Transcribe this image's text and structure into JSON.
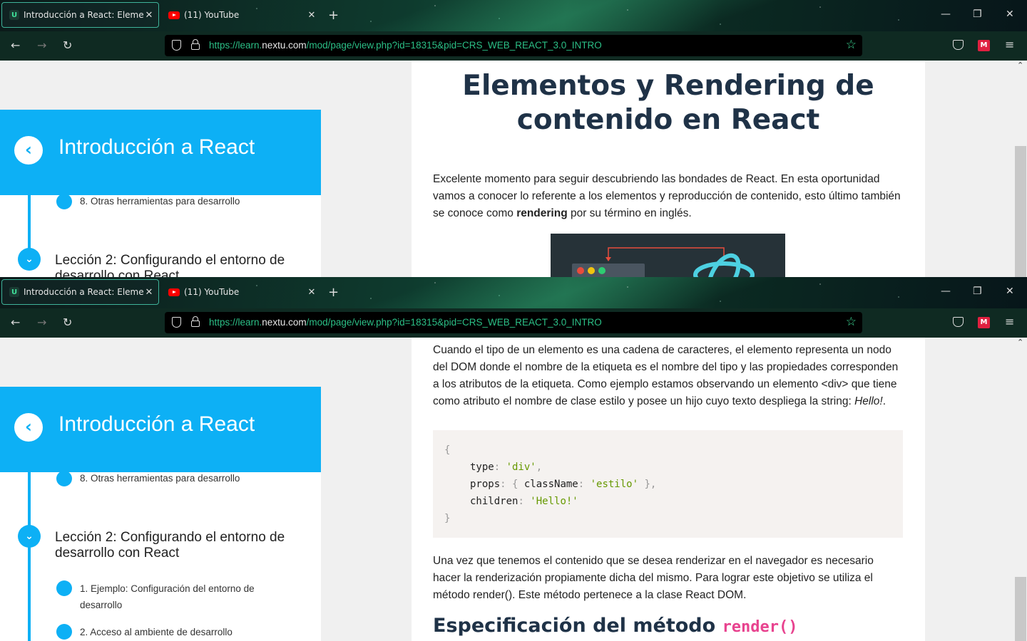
{
  "browser": {
    "tabs": [
      {
        "title": "Introducción a React: Elementos y Rendering"
      },
      {
        "title": "(11) YouTube"
      }
    ],
    "url_scheme": "https://learn.",
    "url_domain": "nextu.com",
    "url_path": "/mod/page/view.php?id=18315&pid=CRS_WEB_REACT_3.0_INTRO",
    "new_tab": "+",
    "close": "✕",
    "back": "←",
    "forward": "→",
    "reload": "↻",
    "bookmark": "☆",
    "menu": "≡",
    "minimize": "—",
    "restore": "❐",
    "window_close": "✕",
    "ext_label": "M"
  },
  "sidebar": {
    "back_icon": "‹",
    "title": "Introducción a React",
    "prev_item": "8. Otras herramientas para desarrollo",
    "lesson2": {
      "title": "Lección 2: Configurando el entorno de desarrollo con React",
      "chevron": "⌄",
      "items": [
        "1. Ejemplo: Configuración del entorno de desarrollo",
        "2. Acceso al ambiente de desarrollo"
      ]
    }
  },
  "content_top": {
    "title": "Elementos y Rendering de contenido en React",
    "intro_before": "Excelente momento para seguir descubriendo las bondades de React. En esta oportunidad vamos a conocer lo referente a los elementos y reproducción de contenido, esto último también se conoce como ",
    "intro_bold": "rendering",
    "intro_after": " por su término en inglés."
  },
  "content_bottom": {
    "para1_before": "Cuando el tipo de un elemento es una cadena de caracteres, el elemento representa un nodo del DOM donde el nombre de la etiqueta es el nombre del tipo y las propiedades corresponden a los atributos de la etiqueta. Como ejemplo estamos observando un elemento <div> que tiene como atributo el nombre de clase estilo y posee un hijo cuyo texto despliega la string: ",
    "para1_italic": "Hello!",
    "para1_after": ".",
    "code": {
      "open": "{",
      "type_key": "type",
      "type_val": "'div'",
      "props_key": "props",
      "classname_key": "className",
      "classname_val": "'estilo'",
      "children_key": "children",
      "children_val": "'Hello!'",
      "close": "}"
    },
    "para2": "Una vez que tenemos el contenido que se desea renderizar en el navegador es necesario hacer la renderización propiamente dicha del mismo. Para lograr este objetivo se utiliza el método render(). Este método pertenece a la clase React DOM.",
    "h2_text": "Especificación del método ",
    "h2_code": "render()"
  },
  "colors": {
    "accent": "#0db0f5",
    "heading": "#1f3247",
    "code_string": "#669900",
    "inline_code": "#e8438f"
  }
}
